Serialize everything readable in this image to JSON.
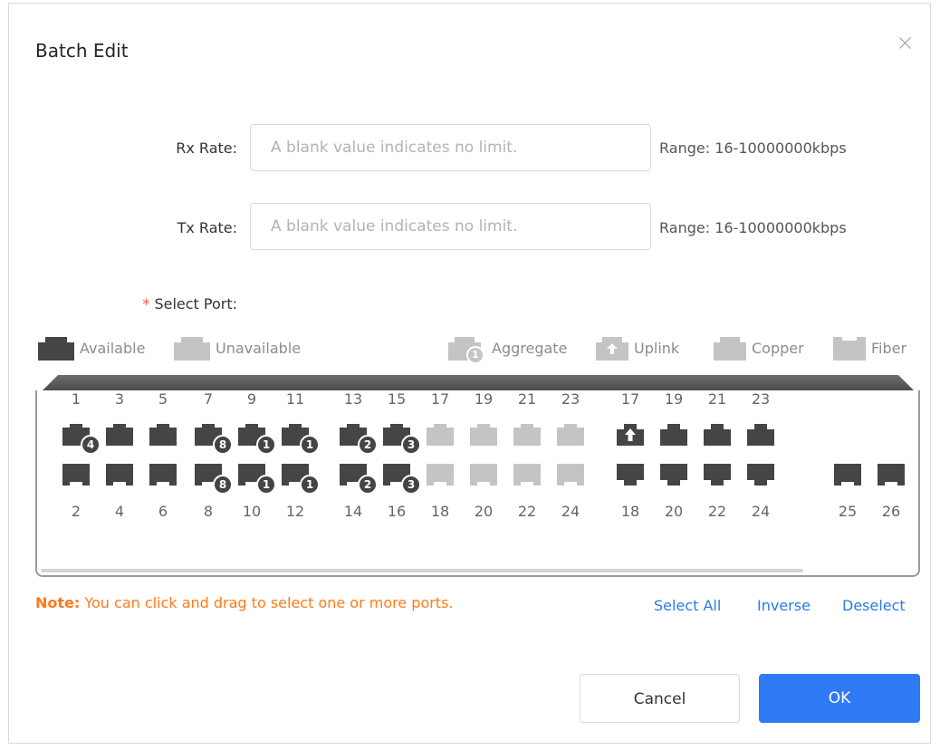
{
  "dialog": {
    "title": "Batch Edit"
  },
  "form": {
    "rx_label": "Rx Rate:",
    "rx_placeholder": "A blank value indicates no limit.",
    "rx_hint": "Range: 16-10000000kbps",
    "tx_label": "Tx Rate:",
    "tx_placeholder": "A blank value indicates no limit.",
    "tx_hint": "Range: 16-10000000kbps",
    "required_star": "*",
    "select_port_label": "Select Port:"
  },
  "legend": {
    "available": "Available",
    "unavailable": "Unavailable",
    "aggregate": "Aggregate",
    "aggregate_badge": "1",
    "uplink": "Uplink",
    "copper": "Copper",
    "fiber": "Fiber"
  },
  "ports": [
    {
      "label": "1",
      "row": "top",
      "status": "available",
      "badge": "4",
      "kind": "copper"
    },
    {
      "label": "2",
      "row": "bottom",
      "status": "available",
      "badge": "",
      "kind": "copper"
    },
    {
      "label": "3",
      "row": "top",
      "status": "available",
      "badge": "",
      "kind": "copper"
    },
    {
      "label": "4",
      "row": "bottom",
      "status": "available",
      "badge": "",
      "kind": "copper"
    },
    {
      "label": "5",
      "row": "top",
      "status": "available",
      "badge": "",
      "kind": "copper"
    },
    {
      "label": "6",
      "row": "bottom",
      "status": "available",
      "badge": "",
      "kind": "copper"
    },
    {
      "label": "7",
      "row": "top",
      "status": "available",
      "badge": "8",
      "kind": "copper"
    },
    {
      "label": "8",
      "row": "bottom",
      "status": "available",
      "badge": "8",
      "kind": "copper"
    },
    {
      "label": "9",
      "row": "top",
      "status": "available",
      "badge": "1",
      "kind": "copper"
    },
    {
      "label": "10",
      "row": "bottom",
      "status": "available",
      "badge": "1",
      "kind": "copper"
    },
    {
      "label": "11",
      "row": "top",
      "status": "available",
      "badge": "1",
      "kind": "copper"
    },
    {
      "label": "12",
      "row": "bottom",
      "status": "available",
      "badge": "1",
      "kind": "copper"
    },
    {
      "label": "13",
      "row": "top",
      "status": "available",
      "badge": "2",
      "kind": "copper"
    },
    {
      "label": "14",
      "row": "bottom",
      "status": "available",
      "badge": "2",
      "kind": "copper"
    },
    {
      "label": "15",
      "row": "top",
      "status": "available",
      "badge": "3",
      "kind": "copper"
    },
    {
      "label": "16",
      "row": "bottom",
      "status": "available",
      "badge": "3",
      "kind": "copper"
    },
    {
      "label": "17",
      "row": "top",
      "status": "unavailable",
      "badge": "",
      "kind": "copper"
    },
    {
      "label": "18",
      "row": "bottom",
      "status": "unavailable",
      "badge": "",
      "kind": "copper"
    },
    {
      "label": "19",
      "row": "top",
      "status": "unavailable",
      "badge": "",
      "kind": "copper"
    },
    {
      "label": "20",
      "row": "bottom",
      "status": "unavailable",
      "badge": "",
      "kind": "copper"
    },
    {
      "label": "21",
      "row": "top",
      "status": "unavailable",
      "badge": "",
      "kind": "copper"
    },
    {
      "label": "22",
      "row": "bottom",
      "status": "unavailable",
      "badge": "",
      "kind": "copper"
    },
    {
      "label": "23",
      "row": "top",
      "status": "unavailable",
      "badge": "",
      "kind": "copper"
    },
    {
      "label": "24",
      "row": "bottom",
      "status": "unavailable",
      "badge": "",
      "kind": "copper"
    },
    {
      "label": "17",
      "row": "top",
      "status": "available",
      "badge": "",
      "kind": "uplink"
    },
    {
      "label": "18",
      "row": "bottom",
      "status": "available",
      "badge": "",
      "kind": "rj45"
    },
    {
      "label": "19",
      "row": "top",
      "status": "available",
      "badge": "",
      "kind": "rj45"
    },
    {
      "label": "20",
      "row": "bottom",
      "status": "available",
      "badge": "",
      "kind": "rj45"
    },
    {
      "label": "21",
      "row": "top",
      "status": "available",
      "badge": "",
      "kind": "rj45"
    },
    {
      "label": "22",
      "row": "bottom",
      "status": "available",
      "badge": "",
      "kind": "rj45"
    },
    {
      "label": "23",
      "row": "top",
      "status": "available",
      "badge": "",
      "kind": "rj45"
    },
    {
      "label": "24",
      "row": "bottom",
      "status": "available",
      "badge": "",
      "kind": "rj45"
    },
    {
      "label": "25",
      "row": "bottom",
      "status": "available",
      "badge": "",
      "kind": "copper"
    },
    {
      "label": "26",
      "row": "bottom",
      "status": "available",
      "badge": "",
      "kind": "copper"
    }
  ],
  "note": {
    "prefix": "Note:",
    "text": " You can click and drag to select one or more ports."
  },
  "actions": {
    "select_all": "Select All",
    "inverse": "Inverse",
    "deselect": "Deselect"
  },
  "buttons": {
    "cancel": "Cancel",
    "ok": "OK"
  },
  "colors": {
    "available": "#454545",
    "unavailable": "#c4c4c4",
    "primary": "#2f7bf5",
    "note": "#ff7a1a",
    "link": "#2c7be5"
  }
}
